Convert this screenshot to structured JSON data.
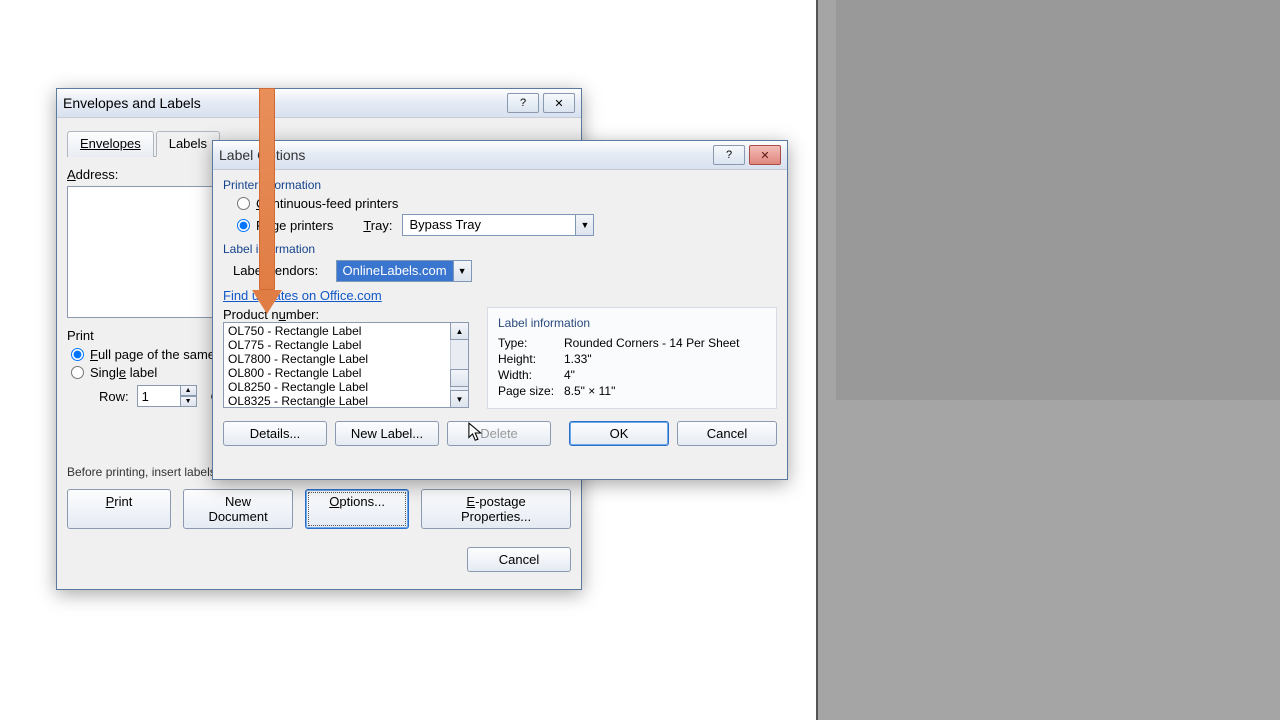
{
  "dlg1": {
    "title": "Envelopes and Labels",
    "tabs": {
      "envelopes": "Envelopes",
      "labels": "Labels"
    },
    "address_label": "Address:",
    "print_group": "Print",
    "full_page": "Full page of the same label",
    "single_label": "Single label",
    "row_label": "Row:",
    "row_value": "1",
    "hint": "Before printing, insert labels in your printer's manual feeder.",
    "btn_print": "Print",
    "btn_newdoc": "New Document",
    "btn_options": "Options...",
    "btn_epostage": "E-postage Properties...",
    "btn_cancel": "Cancel"
  },
  "dlg2": {
    "title": "Label Options",
    "printer_info": "Printer information",
    "r_continuous": "Continuous-feed printers",
    "r_page": "Page printers",
    "tray_label": "Tray:",
    "tray_value": "Bypass Tray",
    "label_info_title": "Label information",
    "vendor_label": "Label vendors:",
    "vendor_value": "OnlineLabels.com",
    "update_link": "Find updates on Office.com",
    "product_label": "Product number:",
    "products": [
      "OL750 - Rectangle Label",
      "OL775 - Rectangle Label",
      "OL7800 - Rectangle Label",
      "OL800 - Rectangle Label",
      "OL8250 - Rectangle Label",
      "OL8325 - Rectangle Label"
    ],
    "details_title": "Label information",
    "detail_type_k": "Type:",
    "detail_type_v": "Rounded Corners - 14 Per Sheet",
    "detail_height_k": "Height:",
    "detail_height_v": "1.33\"",
    "detail_width_k": "Width:",
    "detail_width_v": "4\"",
    "detail_page_k": "Page size:",
    "detail_page_v": "8.5\" × 11\"",
    "btn_details": "Details...",
    "btn_newlabel": "New Label...",
    "btn_delete": "Delete",
    "btn_ok": "OK",
    "btn_cancel": "Cancel"
  }
}
